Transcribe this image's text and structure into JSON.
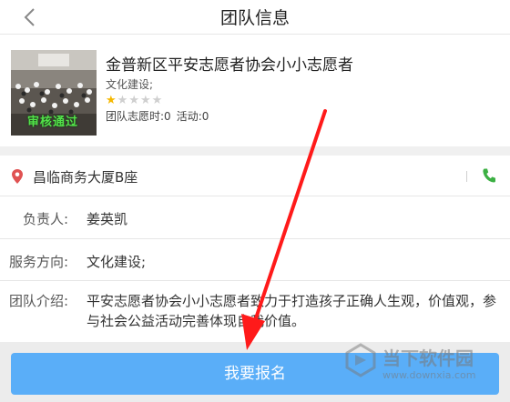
{
  "header": {
    "title": "团队信息",
    "back_icon": "chevron-left-icon"
  },
  "team": {
    "name": "金普新区平安志愿者协会小小志愿者",
    "tags": "文化建设;",
    "rating": 1,
    "rating_max": 5,
    "hours_label": "团队志愿时:0",
    "activities_label": "活动:0",
    "photo_caption": "审核通过"
  },
  "address": {
    "text": "昌临商务大厦B座",
    "pin_icon": "map-pin-icon",
    "phone_icon": "phone-icon"
  },
  "details": {
    "leader_label": "负责人:",
    "leader_value": "姜英凯",
    "service_label": "服务方向:",
    "service_value": "文化建设;",
    "intro_label": "团队介绍:",
    "intro_value": "平安志愿者协会小小志愿者致力于打造孩子正确人生观，价值观，参与社会公益活动完善体现自我价值。"
  },
  "footer": {
    "join_label": "我要报名"
  },
  "watermark": {
    "text": "当下软件园",
    "url": "www.downxia.com"
  },
  "colors": {
    "accent": "#5aaef8",
    "pin": "#e05252",
    "phone": "#3cb043",
    "star_on": "#f5b800",
    "arrow": "#ff1a1a"
  }
}
